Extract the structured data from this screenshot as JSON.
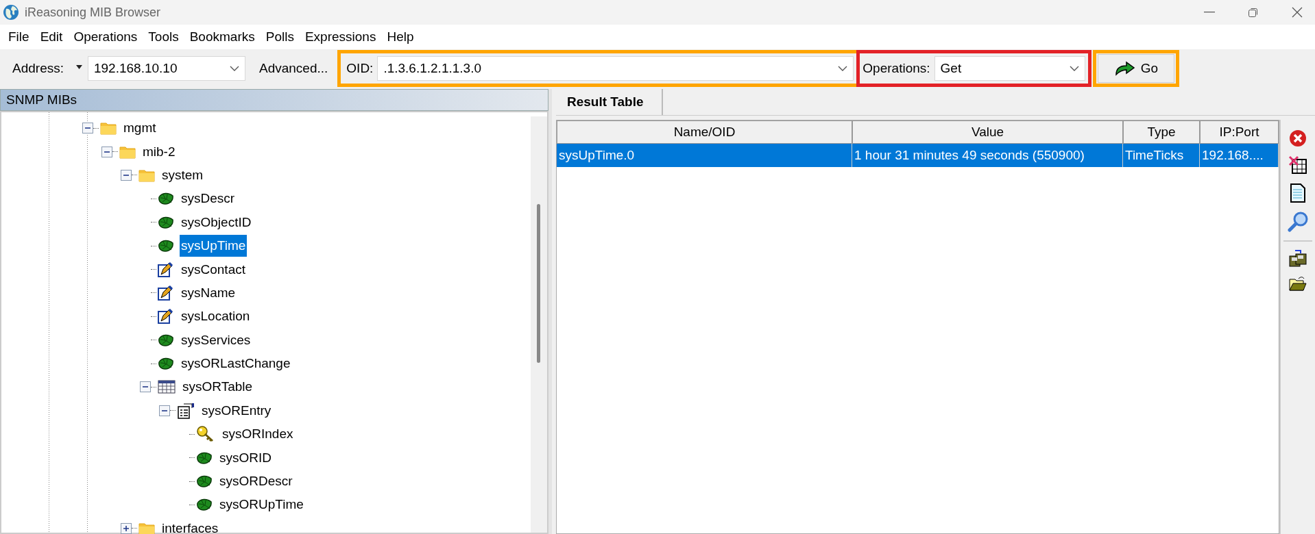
{
  "window": {
    "title": "iReasoning MIB Browser"
  },
  "menu": [
    "File",
    "Edit",
    "Operations",
    "Tools",
    "Bookmarks",
    "Polls",
    "Expressions",
    "Help"
  ],
  "toolbar": {
    "address": {
      "label": "Address:",
      "value": "192.168.10.10"
    },
    "advanced_button": "Advanced...",
    "oid": {
      "label": "OID:",
      "value": ".1.3.6.1.2.1.1.3.0",
      "color": "#ffa500"
    },
    "operations": {
      "label": "Operations:",
      "value": "Get",
      "color": "#e32227"
    },
    "go_button": {
      "label": "Go",
      "color": "#ffa500"
    }
  },
  "tree": {
    "title": "SNMP MIBs",
    "nodes": [
      {
        "label": "mgmt",
        "kind": "folder",
        "expanded": true,
        "selected": false,
        "children": [
          {
            "label": "mib-2",
            "kind": "folder",
            "expanded": true,
            "selected": false,
            "children": [
              {
                "label": "system",
                "kind": "folder",
                "expanded": true,
                "selected": false,
                "children": [
                  {
                    "label": "sysDescr",
                    "kind": "leaf",
                    "selected": false
                  },
                  {
                    "label": "sysObjectID",
                    "kind": "leaf",
                    "selected": false
                  },
                  {
                    "label": "sysUpTime",
                    "kind": "leaf",
                    "selected": true
                  },
                  {
                    "label": "sysContact",
                    "kind": "writable",
                    "selected": false
                  },
                  {
                    "label": "sysName",
                    "kind": "writable",
                    "selected": false
                  },
                  {
                    "label": "sysLocation",
                    "kind": "writable",
                    "selected": false
                  },
                  {
                    "label": "sysServices",
                    "kind": "leaf",
                    "selected": false
                  },
                  {
                    "label": "sysORLastChange",
                    "kind": "leaf",
                    "selected": false
                  },
                  {
                    "label": "sysORTable",
                    "kind": "table",
                    "expanded": true,
                    "selected": false,
                    "children": [
                      {
                        "label": "sysOREntry",
                        "kind": "entry",
                        "expanded": true,
                        "selected": false,
                        "children": [
                          {
                            "label": "sysORIndex",
                            "kind": "key",
                            "selected": false
                          },
                          {
                            "label": "sysORID",
                            "kind": "leaf",
                            "selected": false
                          },
                          {
                            "label": "sysORDescr",
                            "kind": "leaf",
                            "selected": false
                          },
                          {
                            "label": "sysORUpTime",
                            "kind": "leaf",
                            "selected": false
                          }
                        ]
                      }
                    ]
                  }
                ]
              },
              {
                "label": "interfaces",
                "kind": "folder",
                "expanded": false,
                "selected": false
              }
            ]
          }
        ]
      }
    ]
  },
  "results": {
    "tabs": [
      {
        "label": "Result Table",
        "selected": true
      }
    ],
    "columns": [
      "Name/OID",
      "Value",
      "Type",
      "IP:Port"
    ],
    "rows": [
      {
        "cells": [
          "sysUpTime.0",
          "1 hour 31 minutes 49 seconds (550900)",
          "TimeTicks",
          "192.168...."
        ],
        "selected": true
      }
    ]
  }
}
